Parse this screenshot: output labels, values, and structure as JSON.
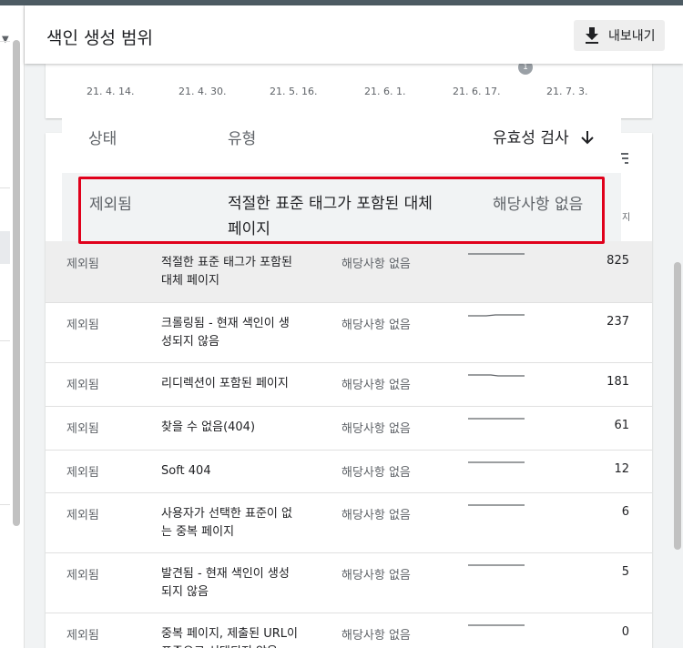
{
  "header": {
    "title": "색인 생성 범위",
    "export_label": "내보내기"
  },
  "chart": {
    "ticks": [
      "21. 4. 14.",
      "21. 4. 30.",
      "21. 5. 16.",
      "21. 6. 1.",
      "21. 6. 17.",
      "21. 7. 3."
    ],
    "marker": "1"
  },
  "popup": {
    "col_status": "상태",
    "col_type": "유형",
    "col_validation": "유효성 검사",
    "status": "제외됨",
    "type": "적절한 표준 태그가 포함된 대체 페이지",
    "validation": "해당사항 없음"
  },
  "table": {
    "header_tail": "지",
    "rows": [
      {
        "status": "제외됨",
        "type": "적절한 표준 태그가 포함된 대체 페이지",
        "validation": "해당사항 없음",
        "count": "825"
      },
      {
        "status": "제외됨",
        "type": "크롤링됨 - 현재 색인이 생성되지 않음",
        "validation": "해당사항 없음",
        "count": "237"
      },
      {
        "status": "제외됨",
        "type": "리디렉션이 포함된 페이지",
        "validation": "해당사항 없음",
        "count": "181"
      },
      {
        "status": "제외됨",
        "type": "찾을 수 없음(404)",
        "validation": "해당사항 없음",
        "count": "61"
      },
      {
        "status": "제외됨",
        "type": "Soft 404",
        "validation": "해당사항 없음",
        "count": "12"
      },
      {
        "status": "제외됨",
        "type": "사용자가 선택한 표준이 없는 중복 페이지",
        "validation": "해당사항 없음",
        "count": "6"
      },
      {
        "status": "제외됨",
        "type": "발견됨 - 현재 색인이 생성되지 않음",
        "validation": "해당사항 없음",
        "count": "5"
      },
      {
        "status": "제외됨",
        "type": "중복 페이지, 제출된 URL이 표준으로 선택되지 않음",
        "validation": "해당사항 없음",
        "count": "0"
      }
    ]
  },
  "colors": {
    "highlight": "#e0001b",
    "row_selected": "#eeeeee"
  }
}
